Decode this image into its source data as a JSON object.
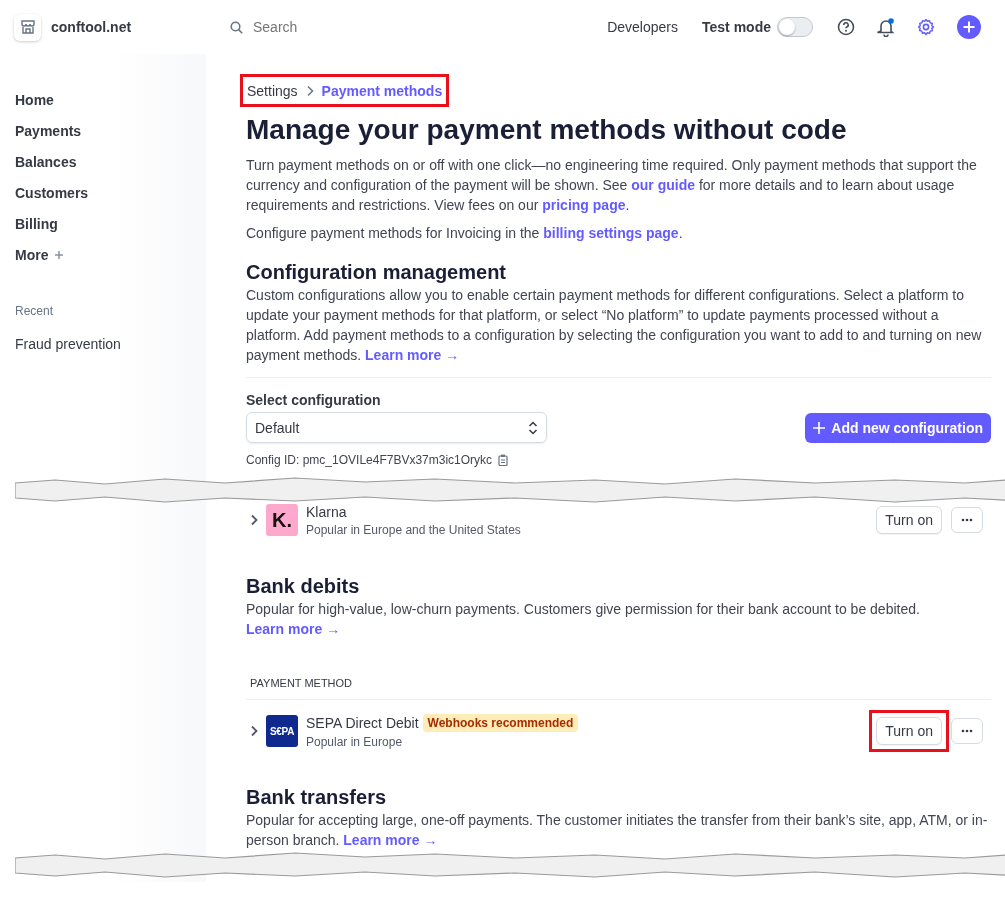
{
  "account": {
    "name": "conftool.net"
  },
  "search": {
    "placeholder": "Search"
  },
  "topbar": {
    "developers": "Developers",
    "test_mode": {
      "label": "Test mode",
      "on": false
    }
  },
  "sidebar": {
    "items": [
      {
        "label": "Home"
      },
      {
        "label": "Payments"
      },
      {
        "label": "Balances"
      },
      {
        "label": "Customers"
      },
      {
        "label": "Billing"
      },
      {
        "label": "More",
        "kind": "expander"
      }
    ],
    "recent_heading": "Recent",
    "recent": [
      {
        "label": "Fraud prevention"
      }
    ]
  },
  "breadcrumb": {
    "highlighted": true,
    "items": [
      {
        "label": "Settings",
        "selected": false
      },
      {
        "label": "Payment methods",
        "selected": true
      }
    ]
  },
  "page_title": "Manage your payment methods without code",
  "intro": [
    [
      {
        "kind": "text",
        "text": "Turn payment methods on or off with one click—no engineering time required. Only payment methods that support the currency and configuration of the payment will be shown. See "
      },
      {
        "kind": "link",
        "text": "our guide"
      },
      {
        "kind": "text",
        "text": " for more details and to learn about usage requirements and restrictions. View fees on our "
      },
      {
        "kind": "link",
        "text": "pricing page"
      },
      {
        "kind": "text",
        "text": "."
      }
    ],
    [
      {
        "kind": "text",
        "text": "Configure payment methods for Invoicing in the "
      },
      {
        "kind": "link",
        "text": "billing settings page"
      },
      {
        "kind": "text",
        "text": "."
      }
    ]
  ],
  "configuration": {
    "title": "Configuration management",
    "body": [
      {
        "kind": "text",
        "text": "Custom configurations allow you to enable certain payment methods for different configurations. Select a platform to update your payment methods for that platform, or select “No platform” to update payments processed without a platform. Add payment methods to a configuration by selecting the configuration you want to add to and turning on new payment methods. "
      },
      {
        "kind": "link",
        "text": "Learn more →"
      }
    ],
    "select_label": "Select configuration",
    "select_value": "Default",
    "add_button": "Add new configuration",
    "config_id": "Config ID: pmc_1OVILe4F7BVx37m3ic1Orykc"
  },
  "klarna": {
    "name": "Klarna",
    "logo_text": "K.",
    "description": "Popular in Europe and the United States",
    "turn_on": "Turn on",
    "highlighted": false
  },
  "bank_debits": {
    "title": "Bank debits",
    "body": [
      {
        "kind": "text",
        "text": "Popular for high-value, low-churn payments. Customers give permission for their bank account to be debited. "
      },
      {
        "kind": "link",
        "text": "Learn more →"
      }
    ],
    "column": "PAYMENT METHOD",
    "rows": [
      {
        "name": "SEPA Direct Debit",
        "logo_text": "S€PA",
        "badge": "Webhooks recommended",
        "description": "Popular in Europe",
        "turn_on": "Turn on",
        "highlighted": true
      }
    ]
  },
  "bank_transfers": {
    "title": "Bank transfers",
    "body": [
      {
        "kind": "text",
        "text": "Popular for accepting large, one-off payments. The customer initiates the transfer from their bank’s site, app, ATM, or in-person branch. "
      },
      {
        "kind": "link",
        "text": "Learn more →"
      }
    ]
  }
}
